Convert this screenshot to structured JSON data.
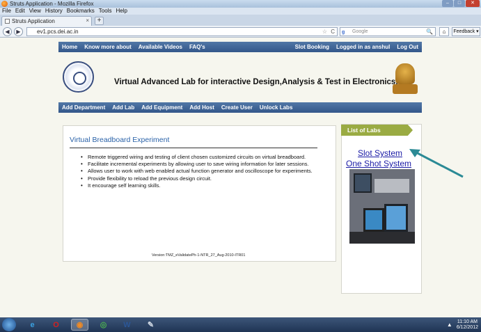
{
  "window": {
    "title": "Struts Application - Mozilla Firefox",
    "controls": [
      "–",
      "□",
      "✕"
    ]
  },
  "menubar": [
    "File",
    "Edit",
    "View",
    "History",
    "Bookmarks",
    "Tools",
    "Help"
  ],
  "tab": {
    "label": "Struts Application",
    "close": "×",
    "new_tab": "+"
  },
  "navbar": {
    "url": "ev1.pcs.dei.ac.in",
    "search_placeholder": "Google",
    "search_engine_glyph": "g",
    "feedback_label": "Feedback ▾",
    "back": "◀",
    "forward": "▶",
    "home": "⌂",
    "star": "☆",
    "reload": "C",
    "magnifier": "🔍"
  },
  "topnav": {
    "left": [
      "Home",
      "Know more about",
      "Available Videos",
      "FAQ's"
    ],
    "right": [
      "Slot Booking",
      "Logged in as anshul",
      "Log Out"
    ]
  },
  "header": {
    "title": "Virtual Advanced Lab for interactive Design,Analysis & Test in Electronics."
  },
  "subnav": [
    "Add Department",
    "Add Lab",
    "Add Equipment",
    "Add Host",
    "Create User",
    "Unlock Labs"
  ],
  "main": {
    "heading": "Virtual Breadboard Experiment",
    "bullets": [
      "Remote triggered wiring and testing of client chosen customized circuits on virtual breadboard.",
      "Facilitate incremental experiments by allowing user to save wiring information for later sessions.",
      "Allows user to work with web enabled actual function generator and oscilloscope for experiments.",
      "Provide flexibility to reload the previous design circuit.",
      "It encourage self learning skills."
    ],
    "version": "Version:TMZ_eValidatePh-1-NTR_27_Aug-2010-ITR01"
  },
  "sidebar": {
    "banner": "List of Labs",
    "links": [
      "Slot System",
      "One Shot System"
    ]
  },
  "taskbar": {
    "apps": [
      {
        "name": "ie-icon",
        "glyph": "e",
        "color": "#3aa0e0"
      },
      {
        "name": "opera-icon",
        "glyph": "O",
        "color": "#d42020"
      },
      {
        "name": "firefox-icon",
        "glyph": "◉",
        "color": "#f08a24"
      },
      {
        "name": "chrome-icon",
        "glyph": "◎",
        "color": "#4caf50"
      },
      {
        "name": "word-icon",
        "glyph": "W",
        "color": "#2b5797"
      },
      {
        "name": "paint-icon",
        "glyph": "✎",
        "color": "#cfd8e3"
      }
    ],
    "time": "11:10 AM",
    "date": "6/12/2012",
    "tray_arrow": "▲"
  }
}
